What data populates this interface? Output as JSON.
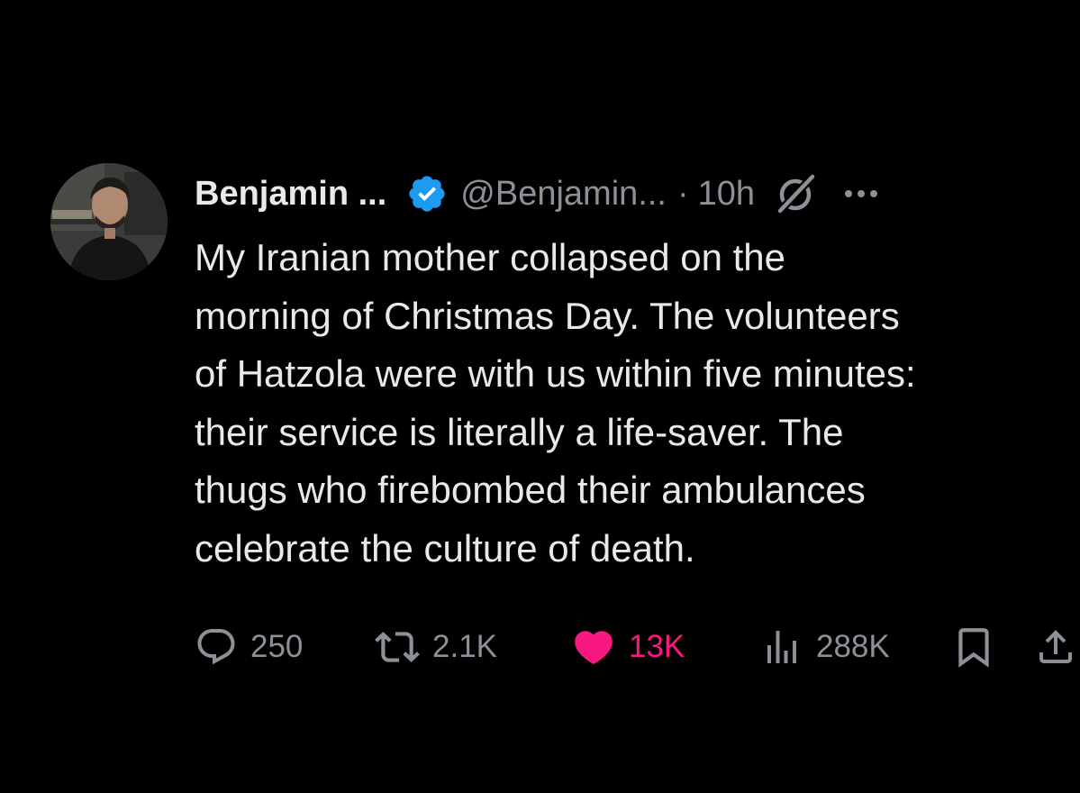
{
  "tweet": {
    "author": {
      "display_name": "Benjamin ...",
      "handle": "@Benjamin...",
      "verified": true,
      "avatar_icon": "profile-photo"
    },
    "separator": "·",
    "timestamp": "10h",
    "grok_icon": "grok-icon",
    "more_icon": "more-icon",
    "text": "My Iranian mother collapsed on the\nmorning of Christmas Day. The volunteers\nof Hatzola were with us within five minutes:\ntheir service is literally a life-saver. The\nthugs who firebombed their ambulances\ncelebrate the culture of death.",
    "actions": {
      "replies": "250",
      "reposts": "2.1K",
      "likes": "13K",
      "views": "288K",
      "liked": true
    }
  },
  "colors": {
    "background": "#000000",
    "text": "#e7e9ea",
    "muted": "#8b9197",
    "verified_blue": "#1d9bf0",
    "like_pink": "#f91880"
  }
}
